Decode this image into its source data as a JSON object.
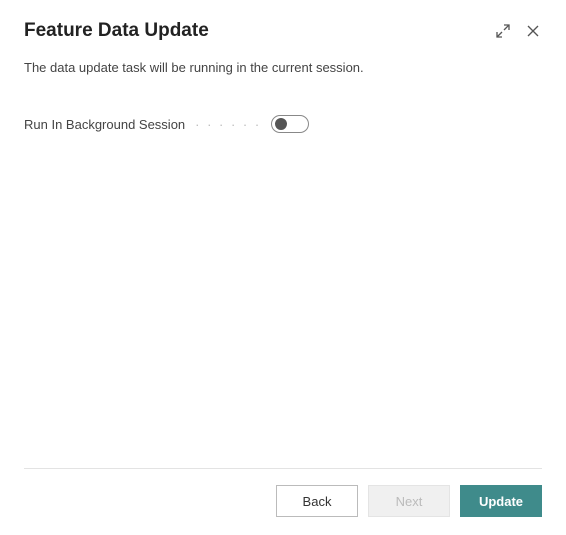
{
  "header": {
    "title": "Feature Data Update"
  },
  "description": "The data update task will be running in the current session.",
  "option": {
    "label": "Run In Background Session",
    "dots": "· · · · · ·",
    "enabled": false
  },
  "footer": {
    "back": "Back",
    "next": "Next",
    "update": "Update"
  }
}
